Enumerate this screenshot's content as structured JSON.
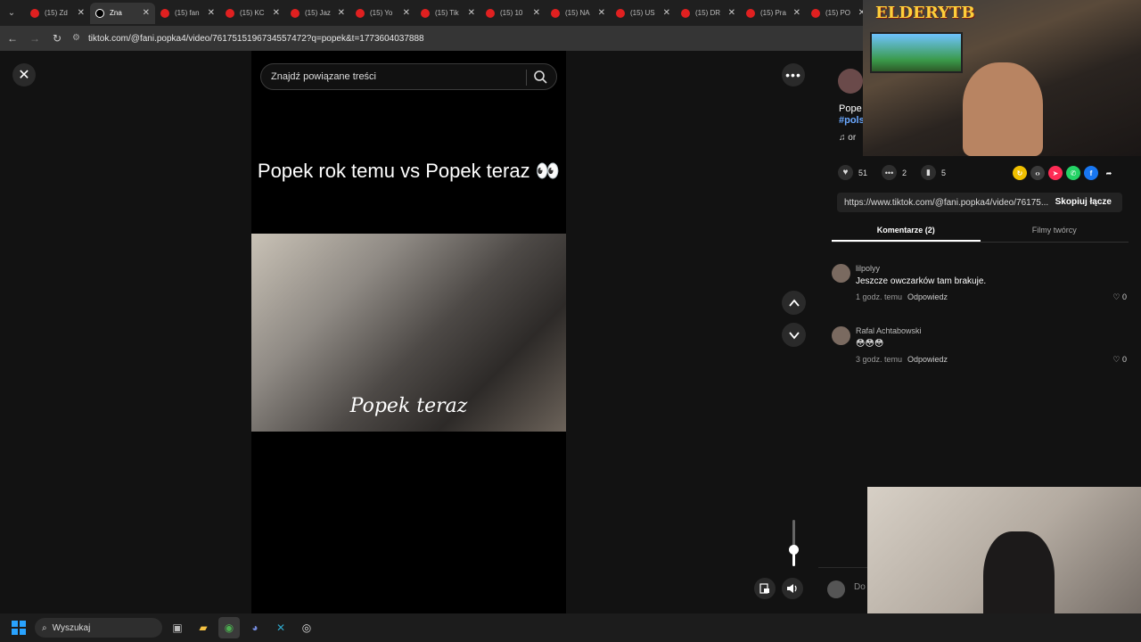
{
  "tabs": [
    {
      "label": "(15) Zd",
      "fav": "youtube-icon",
      "active": false
    },
    {
      "label": "Zna",
      "fav": "tiktok-icon",
      "active": true
    },
    {
      "label": "(15) fan",
      "fav": "youtube-icon",
      "active": false
    },
    {
      "label": "(15) KC",
      "fav": "youtube-icon",
      "active": false
    },
    {
      "label": "(15) Jaz",
      "fav": "youtube-icon",
      "active": false
    },
    {
      "label": "(15) Yo",
      "fav": "youtube-icon",
      "active": false
    },
    {
      "label": "(15) Tik",
      "fav": "youtube-icon",
      "active": false
    },
    {
      "label": "(15) 10",
      "fav": "youtube-icon",
      "active": false
    },
    {
      "label": "(15) NA",
      "fav": "youtube-icon",
      "active": false
    },
    {
      "label": "(15) US",
      "fav": "youtube-icon",
      "active": false
    },
    {
      "label": "(15) DR",
      "fav": "youtube-icon",
      "active": false
    },
    {
      "label": "(15) Pra",
      "fav": "youtube-icon",
      "active": false
    },
    {
      "label": "(15) PO",
      "fav": "youtube-icon",
      "active": false
    }
  ],
  "browser": {
    "url": "tiktok.com/@fani.popka4/video/7617515196734557472?q=popek&t=1773604037888"
  },
  "search": {
    "placeholder": "Znajdź powiązane treści"
  },
  "video": {
    "title": "Popek rok temu vs Popek teraz 👀",
    "caption": "Popek teraz",
    "volume": 0.35
  },
  "post": {
    "desc_line1": "Pope",
    "desc_hashtag": "#pols",
    "desc_sound": "♫ or",
    "likes": "51",
    "comments": "2",
    "saves": "5",
    "link": "https://www.tiktok.com/@fani.popka4/video/76175...",
    "copy_label": "Skopiuj łącze"
  },
  "side_tabs": {
    "comments": "Komentarze (2)",
    "creator_videos": "Filmy twórcy"
  },
  "comments": [
    {
      "user": "lilpolyy",
      "text": "Jeszcze owczarków tam brakuje.",
      "time": "1 godz. temu",
      "reply": "Odpowiedz",
      "likes": "0"
    },
    {
      "user": "Rafal Achtabowski",
      "text": "😳😳😳",
      "time": "3 godz. temu",
      "reply": "Odpowiedz",
      "likes": "0"
    }
  ],
  "add_comment": {
    "placeholder": "Do"
  },
  "stream_overlay": {
    "logo": "ELDERYTB"
  },
  "taskbar": {
    "search": "Wyszukaj"
  }
}
